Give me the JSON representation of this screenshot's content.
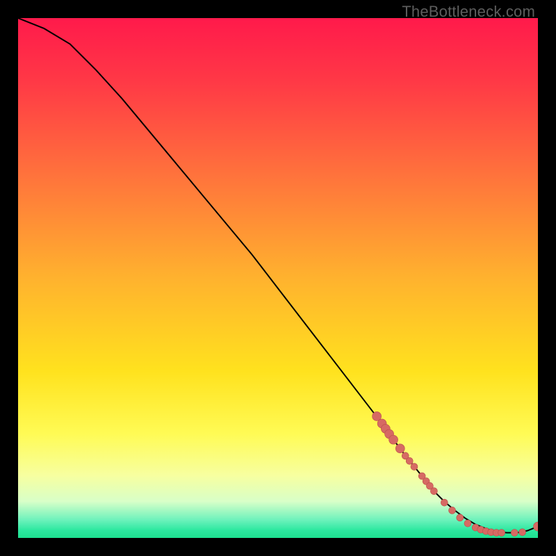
{
  "watermark": "TheBottleneck.com",
  "colors": {
    "gradient_stops": [
      {
        "offset": 0.0,
        "color": "#ff1a4b"
      },
      {
        "offset": 0.12,
        "color": "#ff3846"
      },
      {
        "offset": 0.3,
        "color": "#ff723c"
      },
      {
        "offset": 0.5,
        "color": "#ffb22e"
      },
      {
        "offset": 0.68,
        "color": "#ffe21e"
      },
      {
        "offset": 0.8,
        "color": "#fffb55"
      },
      {
        "offset": 0.88,
        "color": "#f7ffa0"
      },
      {
        "offset": 0.93,
        "color": "#d8ffc8"
      },
      {
        "offset": 0.965,
        "color": "#6ef2bc"
      },
      {
        "offset": 0.985,
        "color": "#2de8a0"
      },
      {
        "offset": 1.0,
        "color": "#1de090"
      }
    ],
    "line": "#000000",
    "marker_fill": "#d66a63",
    "marker_stroke": "#b94f4a"
  },
  "chart_data": {
    "type": "line",
    "title": "",
    "xlabel": "",
    "ylabel": "",
    "xlim": [
      0,
      100
    ],
    "ylim": [
      0,
      100
    ],
    "series": [
      {
        "name": "curve",
        "x": [
          0,
          5,
          10,
          15,
          20,
          25,
          30,
          35,
          40,
          45,
          50,
          55,
          60,
          65,
          70,
          72,
          74,
          76,
          78,
          80,
          82,
          84,
          86,
          88,
          90,
          92,
          94,
          96,
          98,
          100
        ],
        "y": [
          100,
          98,
          95,
          90,
          84.5,
          78.5,
          72.5,
          66.5,
          60.5,
          54.5,
          48,
          41.5,
          35,
          28.5,
          22,
          19.2,
          16.5,
          14,
          11.5,
          9,
          7,
          5.3,
          3.8,
          2.6,
          1.8,
          1.2,
          1,
          1,
          1.4,
          2.2
        ]
      }
    ],
    "markers": [
      {
        "x": 69,
        "y": 23.4
      },
      {
        "x": 70,
        "y": 22.0
      },
      {
        "x": 70.7,
        "y": 21.0
      },
      {
        "x": 71.4,
        "y": 20.0
      },
      {
        "x": 72.2,
        "y": 18.9
      },
      {
        "x": 73.5,
        "y": 17.2
      },
      {
        "x": 74.5,
        "y": 15.8
      },
      {
        "x": 75.3,
        "y": 14.8
      },
      {
        "x": 76.2,
        "y": 13.7
      },
      {
        "x": 77.7,
        "y": 11.9
      },
      {
        "x": 78.5,
        "y": 10.9
      },
      {
        "x": 79.2,
        "y": 10.0
      },
      {
        "x": 80.0,
        "y": 9.0
      },
      {
        "x": 82.0,
        "y": 6.8
      },
      {
        "x": 83.5,
        "y": 5.3
      },
      {
        "x": 85.0,
        "y": 3.9
      },
      {
        "x": 86.5,
        "y": 2.8
      },
      {
        "x": 88.0,
        "y": 2.0
      },
      {
        "x": 89.0,
        "y": 1.6
      },
      {
        "x": 90.0,
        "y": 1.3
      },
      {
        "x": 91.0,
        "y": 1.1
      },
      {
        "x": 92.0,
        "y": 1.0
      },
      {
        "x": 93.0,
        "y": 1.0
      },
      {
        "x": 95.5,
        "y": 1.0
      },
      {
        "x": 97.0,
        "y": 1.1
      },
      {
        "x": 100.0,
        "y": 2.2
      }
    ],
    "marker_radius_small": 5,
    "marker_radius_large": 6.5
  }
}
